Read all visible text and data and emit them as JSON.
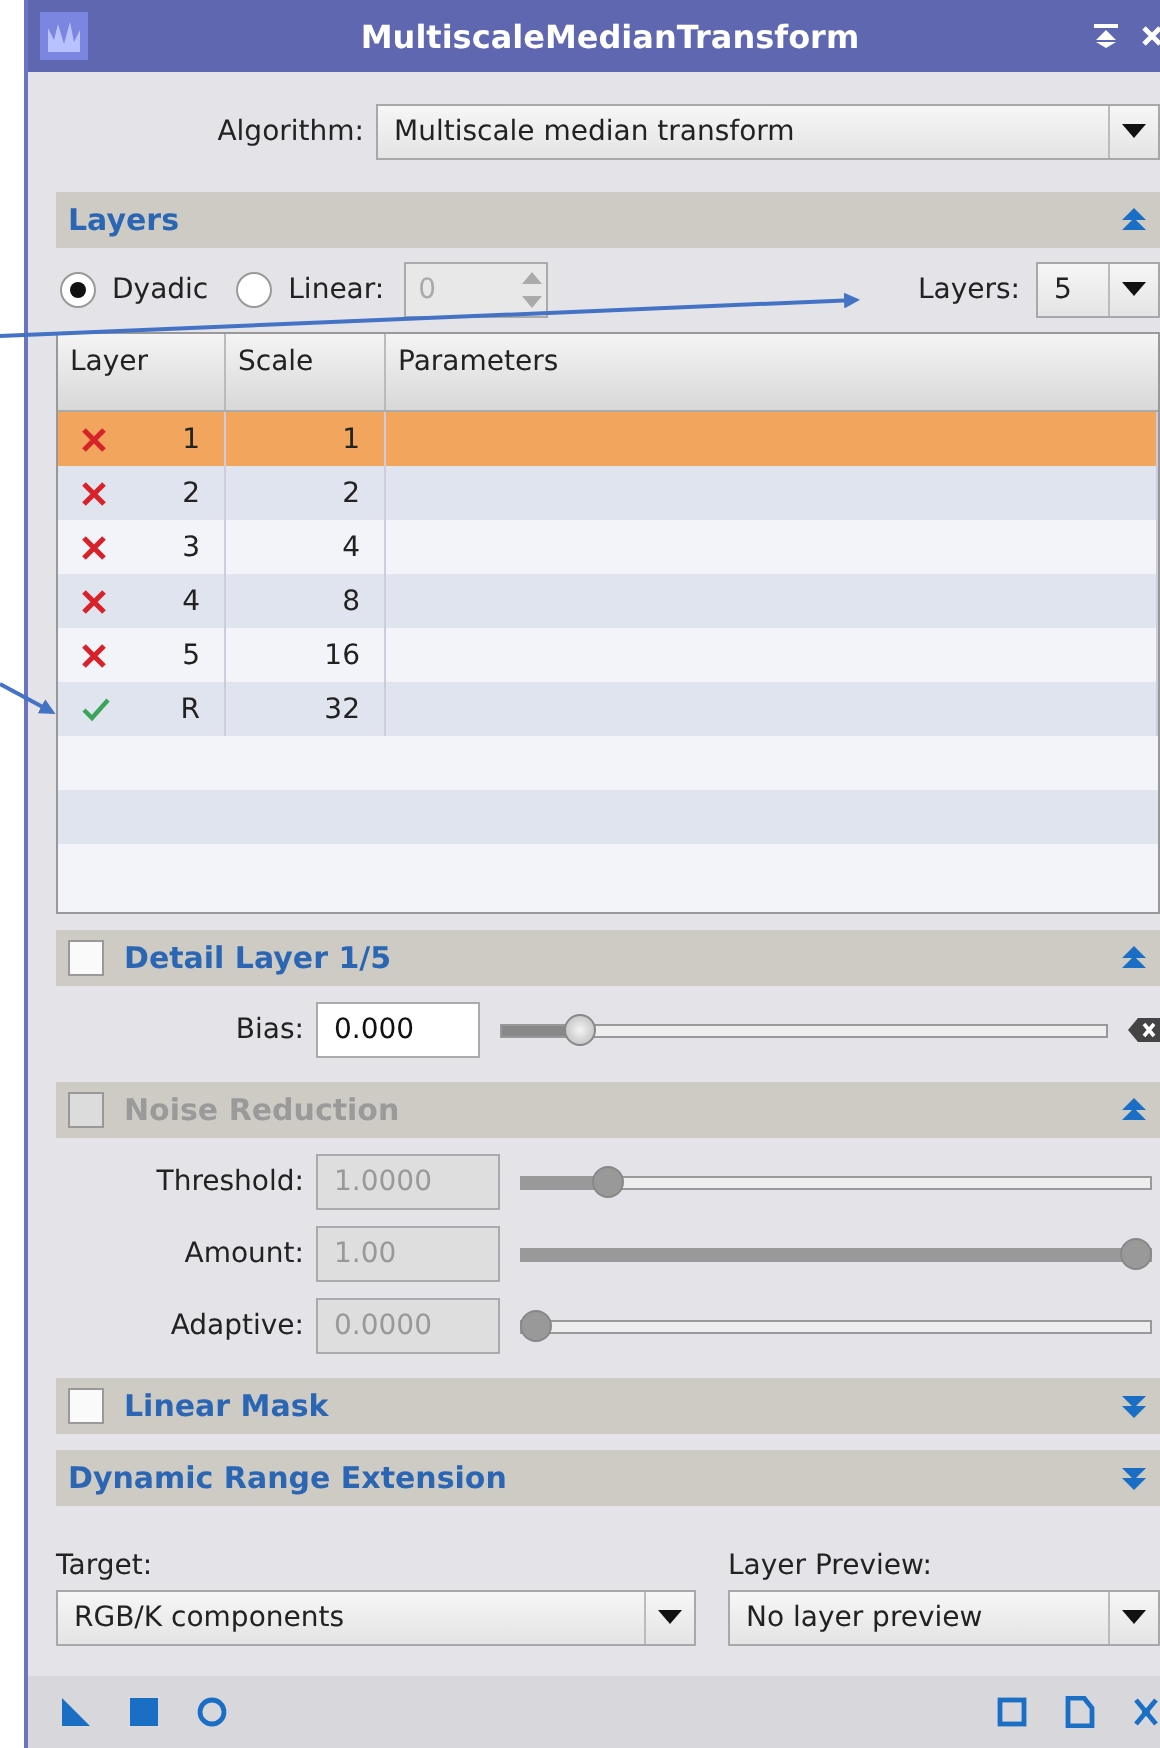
{
  "window": {
    "title": "MultiscaleMedianTransform"
  },
  "algorithm": {
    "label": "Algorithm:",
    "value": "Multiscale median transform"
  },
  "layers_section": {
    "title": "Layers",
    "expanded": true,
    "modes": [
      {
        "label": "Dyadic",
        "selected": true
      },
      {
        "label": "Linear:",
        "selected": false
      }
    ],
    "linear_field": {
      "value": "0",
      "disabled": true
    },
    "layers_label": "Layers:",
    "layers_value": "5",
    "table": {
      "columns": [
        "Layer",
        "Scale",
        "Parameters"
      ],
      "rows": [
        {
          "enabled": false,
          "layer": "1",
          "scale": "1",
          "selected": true
        },
        {
          "enabled": false,
          "layer": "2",
          "scale": "2",
          "selected": false
        },
        {
          "enabled": false,
          "layer": "3",
          "scale": "4",
          "selected": false
        },
        {
          "enabled": false,
          "layer": "4",
          "scale": "8",
          "selected": false
        },
        {
          "enabled": false,
          "layer": "5",
          "scale": "16",
          "selected": false
        },
        {
          "enabled": true,
          "layer": "R",
          "scale": "32",
          "selected": false
        }
      ]
    }
  },
  "detail_layer": {
    "title": "Detail Layer 1/5",
    "checked": false,
    "expanded": true,
    "params": [
      {
        "label": "Bias:",
        "value": "0.000",
        "level": 0.11
      }
    ]
  },
  "noise_reduction": {
    "title": "Noise Reduction",
    "checked": false,
    "disabled": true,
    "expanded": true,
    "params": [
      {
        "label": "Threshold:",
        "value": "1.0000",
        "level": 0.12
      },
      {
        "label": "Amount:",
        "value": "1.00",
        "level": 1
      },
      {
        "label": "Adaptive:",
        "value": "0.0000",
        "level": 0
      }
    ]
  },
  "linear_mask": {
    "title": "Linear Mask",
    "checked": false,
    "expanded": false
  },
  "dynamic_range": {
    "title": "Dynamic Range Extension",
    "expanded": false
  },
  "target": {
    "label": "Target:",
    "value": "RGB/K components"
  },
  "layer_preview": {
    "label": "Layer Preview:",
    "value": "No layer preview"
  }
}
